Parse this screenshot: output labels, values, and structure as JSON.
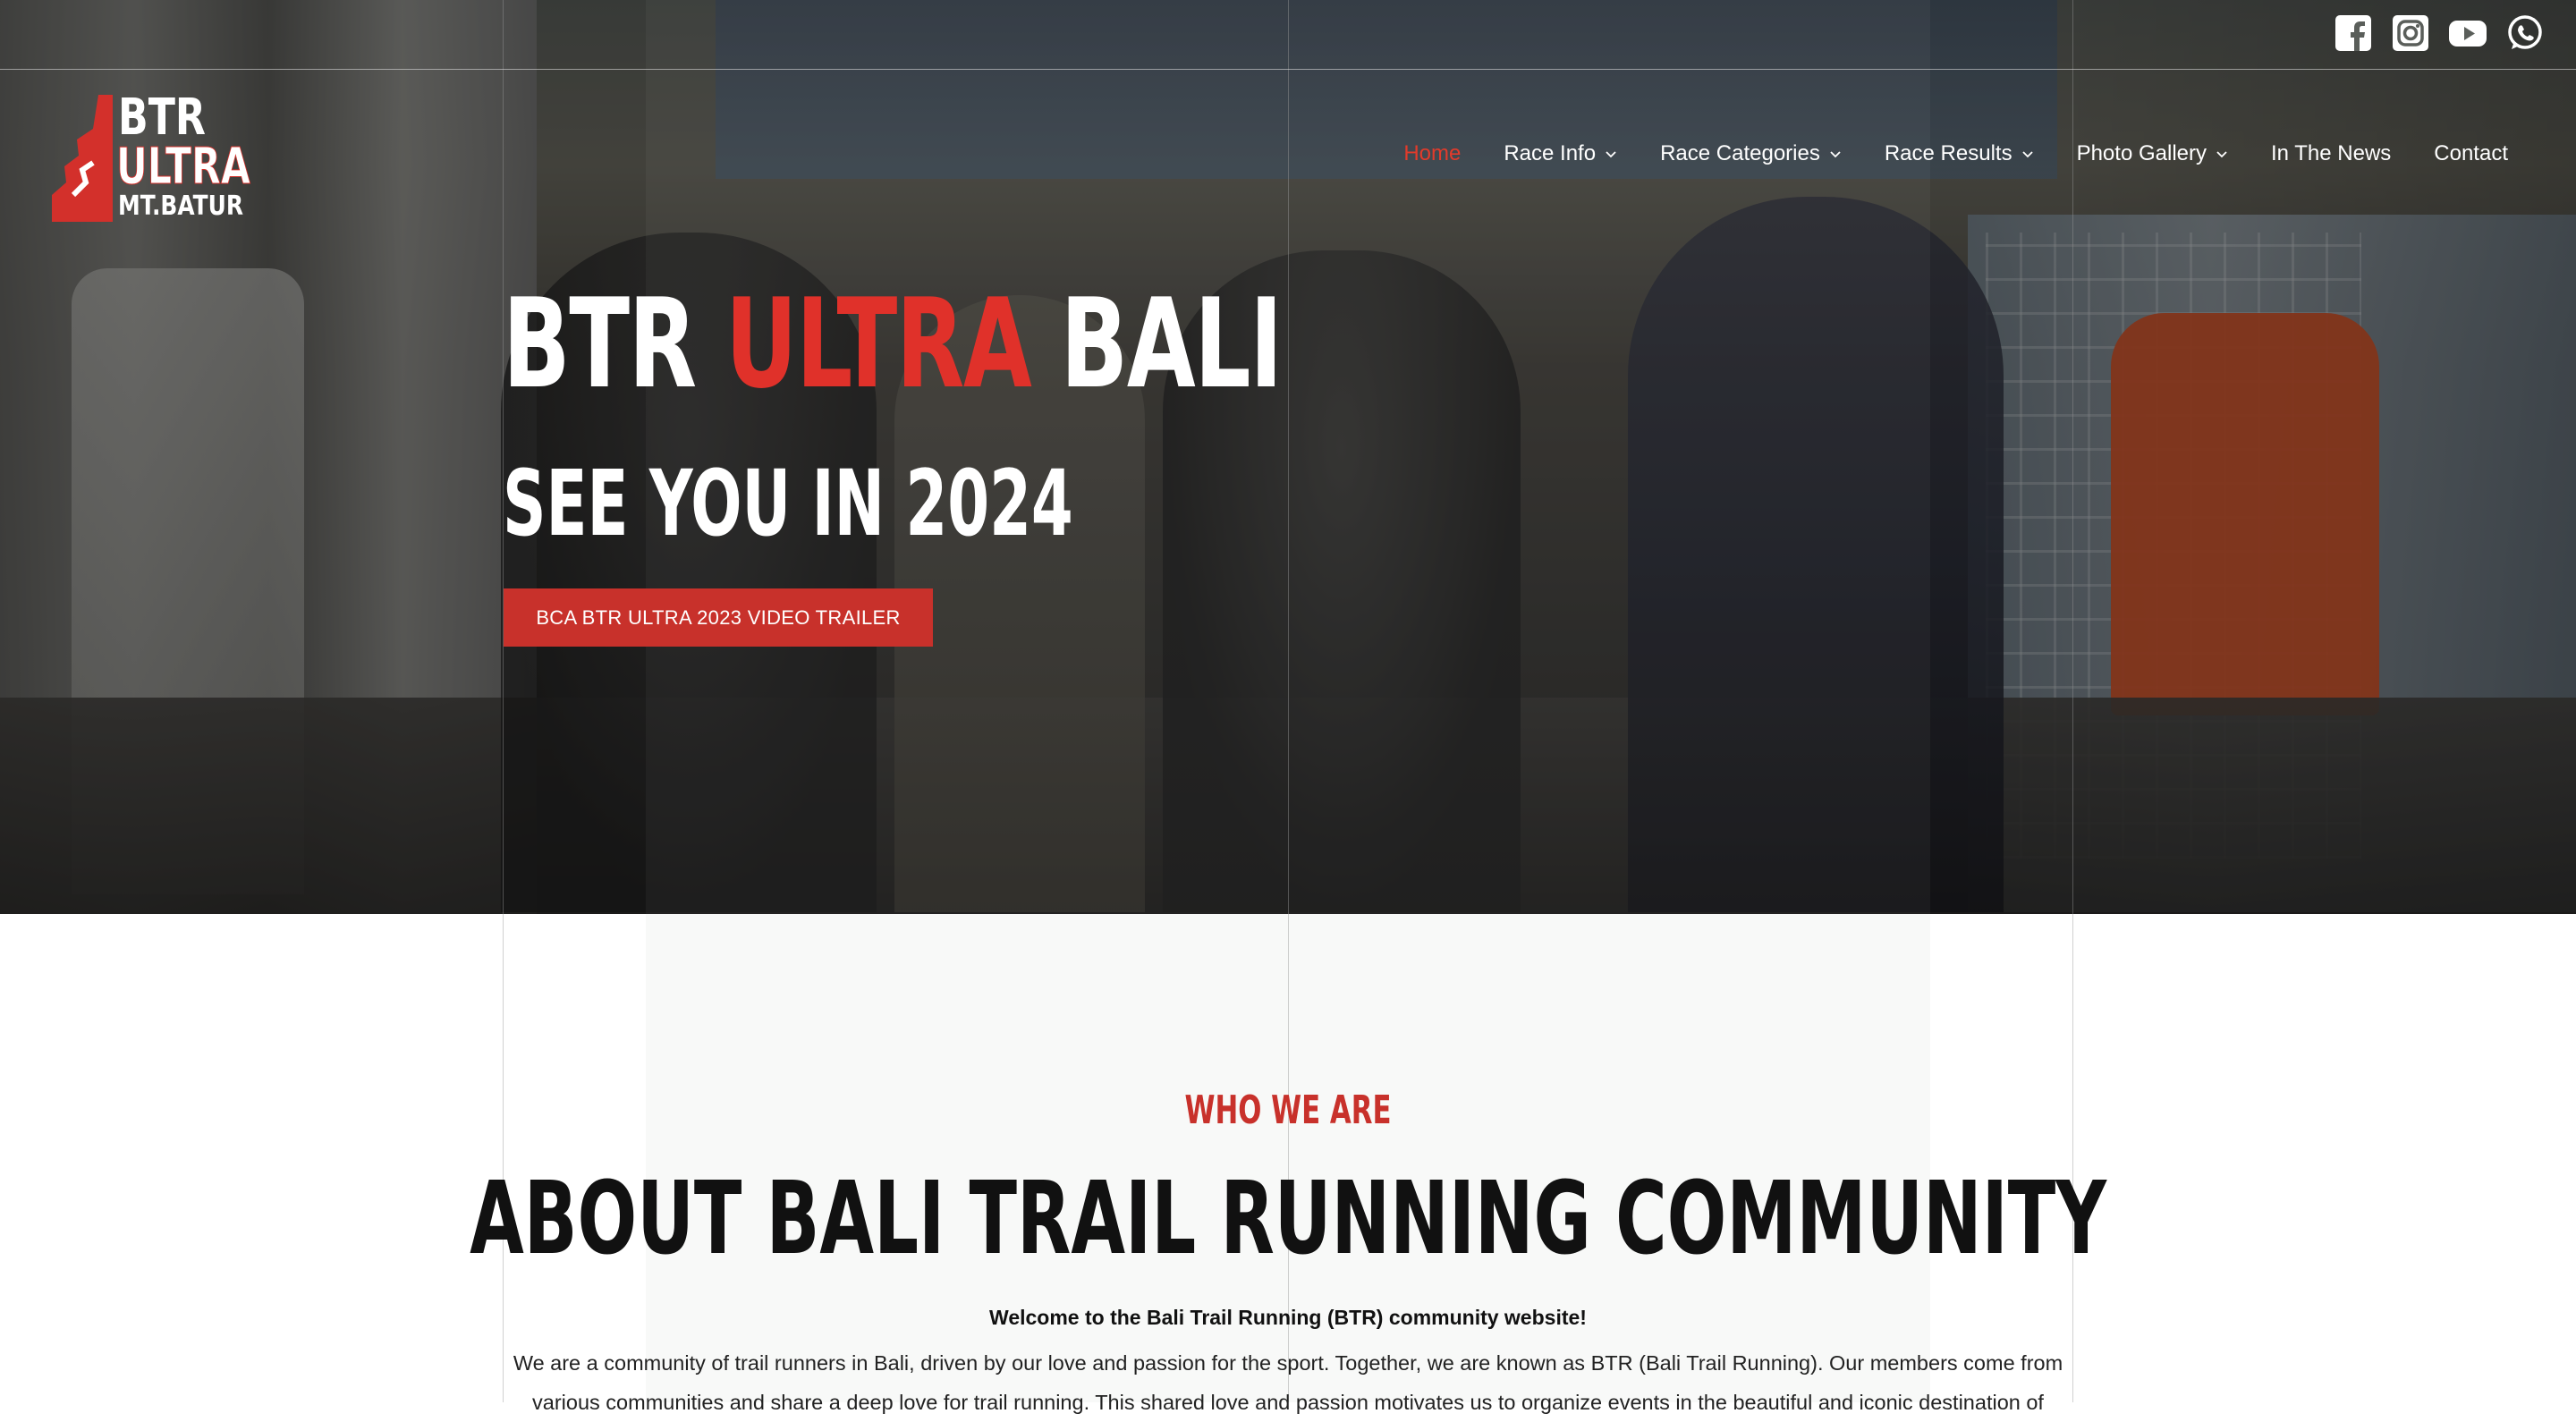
{
  "social": {
    "icons": [
      "facebook-icon",
      "instagram-icon",
      "youtube-icon",
      "whatsapp-icon"
    ]
  },
  "logo": {
    "line1": "BTR",
    "line2": "ULTRA",
    "line3": "MT.BATUR",
    "accent_color": "#d3302b"
  },
  "nav": {
    "items": [
      {
        "label": "Home",
        "active": true
      },
      {
        "label": "Race Info",
        "dropdown": true
      },
      {
        "label": "Race Categories",
        "dropdown": true
      },
      {
        "label": "Race Results",
        "dropdown": true
      },
      {
        "label": "Photo Gallery",
        "dropdown": true
      },
      {
        "label": "In The News"
      },
      {
        "label": "Contact"
      }
    ]
  },
  "hero": {
    "title_part1": "BTR ",
    "title_accent": "ULTRA",
    "title_part2": " BALI",
    "subtitle": "SEE YOU IN 2024",
    "button_label": "BCA BTR ULTRA 2023 VIDEO TRAILER"
  },
  "about": {
    "eyebrow": "WHO WE ARE",
    "title": "ABOUT BALI TRAIL RUNNING COMMUNITY",
    "welcome": "Welcome to the Bali Trail Running (BTR) community website!",
    "paragraph": "We are a community of trail runners in Bali, driven by our love and passion for the sport. Together, we are known as BTR (Bali Trail Running). Our members come from various communities and share a deep love for trail running. This shared love and passion motivates us to organize events in the beautiful and iconic destination of"
  },
  "colors": {
    "accent": "#e0312a",
    "button": "#c8312b",
    "nav_active": "#e23b2b"
  }
}
